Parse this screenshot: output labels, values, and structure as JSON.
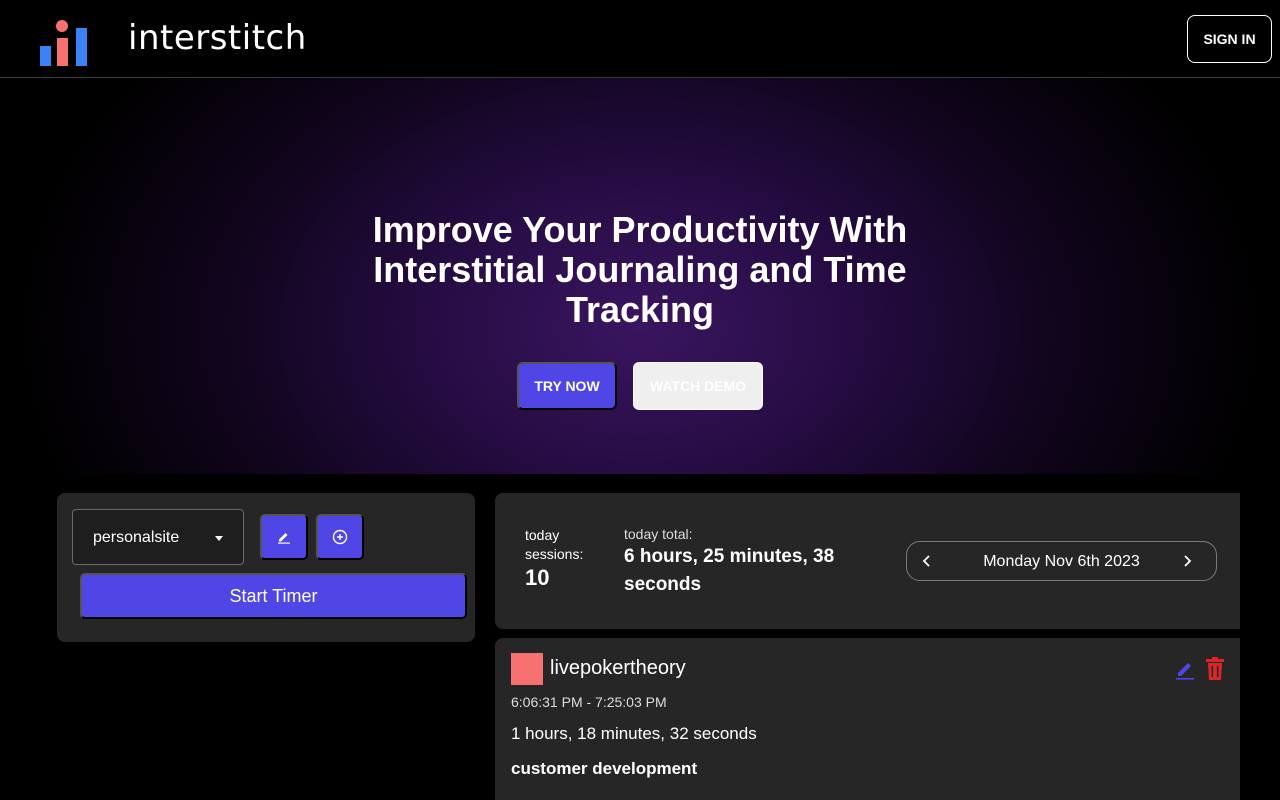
{
  "header": {
    "brand": "interstitch",
    "sign_in_label": "SIGN IN"
  },
  "hero": {
    "title": "Improve Your Productivity With Interstitial Journaling and Time Tracking",
    "try_now_label": "TRY NOW",
    "watch_demo_label": "WATCH DEMO"
  },
  "timer": {
    "project": "personalsite",
    "start_label": "Start Timer"
  },
  "stats": {
    "sessions_label": "today sessions:",
    "sessions_value": "10",
    "total_label": "today total:",
    "total_value": "6 hours, 25 minutes, 38 seconds",
    "date": "Monday Nov 6th 2023"
  },
  "session": {
    "project": "livepokertheory",
    "time_range": "6:06:31 PM - 7:25:03 PM",
    "duration": "1 hours, 18 minutes, 32 seconds",
    "note": "customer development"
  },
  "colors": {
    "accent": "#4f46e5",
    "session_swatch": "#f87171",
    "delete": "#dc2626",
    "logo_blue": "#3b82f6",
    "logo_red": "#f87171"
  },
  "icons": [
    "logo-icon",
    "pencil-icon",
    "plus-circle-icon",
    "chevron-left-icon",
    "chevron-right-icon",
    "trash-icon"
  ]
}
